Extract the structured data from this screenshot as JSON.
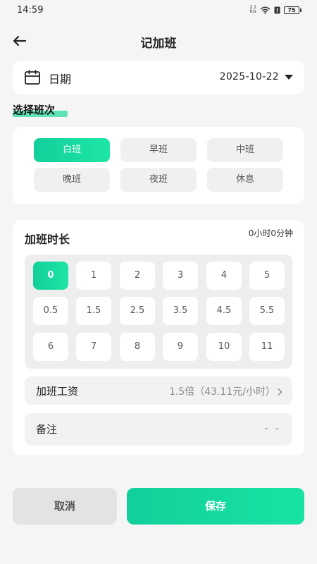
{
  "status_bar": {
    "time": "14:59",
    "net_speed_value": "2.1",
    "net_speed_unit": "K/s",
    "battery": "75",
    "icons": [
      "wifi-icon",
      "alert-icon",
      "battery-icon"
    ]
  },
  "header": {
    "back_icon": "arrow-left-icon",
    "title": "记加班"
  },
  "date": {
    "icon": "calendar-icon",
    "label": "日期",
    "value": "2025-10-22"
  },
  "shift_section": {
    "title": "选择班次",
    "highlight_color": "#5de3b4",
    "shifts": [
      {
        "label": "白班",
        "selected": true
      },
      {
        "label": "早班",
        "selected": false
      },
      {
        "label": "中班",
        "selected": false
      },
      {
        "label": "晚班",
        "selected": false
      },
      {
        "label": "夜班",
        "selected": false
      },
      {
        "label": "休息",
        "selected": false
      }
    ]
  },
  "overtime": {
    "title": "加班时长",
    "total": "0小时0分钟",
    "hours": [
      "0",
      "1",
      "2",
      "3",
      "4",
      "5",
      "0.5",
      "1.5",
      "2.5",
      "3.5",
      "4.5",
      "5.5",
      "6",
      "7",
      "8",
      "9",
      "10",
      "11"
    ],
    "selected_hour": "0",
    "wage_label": "加班工资",
    "wage_value": "1.5倍（43.11元/小时）",
    "note_label": "备注",
    "note_value": "- -"
  },
  "actions": {
    "cancel": "取消",
    "save": "保存"
  },
  "colors": {
    "accent": "#16d79f",
    "background": "#f5f5f5"
  }
}
